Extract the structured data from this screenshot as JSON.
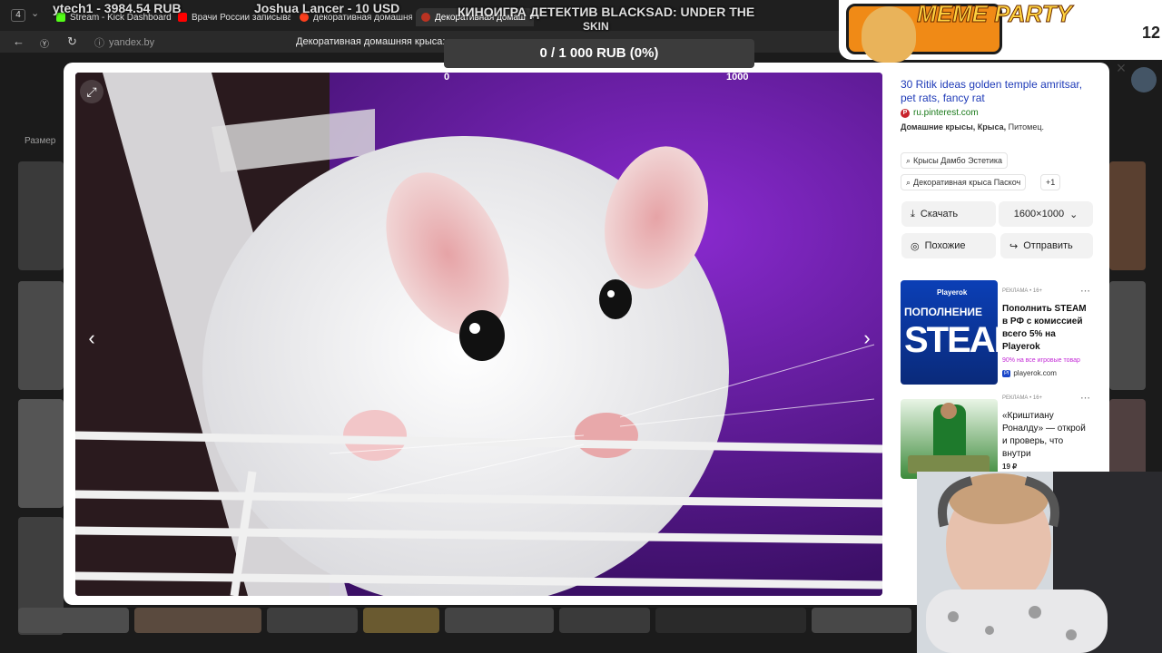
{
  "browser": {
    "tab_count": "4",
    "tabs": [
      {
        "label": "Stream - Kick Dashboard",
        "color": "#53fc18"
      },
      {
        "label": "Врачи России записыва",
        "color": "#ff0000"
      },
      {
        "label": "декоративная домашня",
        "color": "#fc3f1d"
      },
      {
        "label": "Декоративная домаш",
        "color": "#bb3322"
      }
    ],
    "url": "yandex.by",
    "page_title": "Декоративная домашняя крыса: см"
  },
  "stream": {
    "donation_goal": "0 / 1 000 RUB (0%)",
    "ticker_left": "ytech1 - 3984.54 RUB",
    "ticker_mid": "Joshua Lancer - 10 USD",
    "ticker_right_1": "КИНОИГРА ДЕТЕКТИВ BLACKSAD: UNDER THE",
    "ticker_right_2": "SKIN",
    "meme_party": "MEME PARTY",
    "meme_number": "12",
    "goal_min": "0",
    "goal_max": "1000"
  },
  "background": {
    "size_filter": "Размер"
  },
  "viewer": {
    "title": "30 Ritik ideas golden temple amritsar, pet rats, fancy rat",
    "site": "ru.pinterest.com",
    "tags_bold": "Домашние крысы, Крыса,",
    "tags_rest": " Питомец.",
    "chips": [
      "Крысы Дамбо Эстетика",
      "Декоративная крыса Паскоч",
      "+1"
    ],
    "download_label": "Скачать",
    "resolution": "1600×1000",
    "similar_label": "Похожие",
    "share_label": "Отправить"
  },
  "ads": [
    {
      "label": "РЕКЛАМА • 16+",
      "image_text_1": "Playerok",
      "image_text_2": "ПОПОЛНЕНИЕ",
      "image_text_3": "STEAM",
      "title": "Пополнить STEAM в РФ с комиссией всего 5% на Playerok",
      "subtitle": "90% на все игровые товар",
      "site": "playerok.com",
      "site_badge": "Pl"
    },
    {
      "label": "РЕКЛАМА • 16+",
      "title": "«Криштиану Роналду» — открой и проверь, что внутри",
      "price": "19 ₽"
    }
  ],
  "colors": {
    "link": "#1f3bb8",
    "site": "#1a7a1a",
    "pinterest": "#c8232c",
    "accent": "#c32ad6"
  }
}
